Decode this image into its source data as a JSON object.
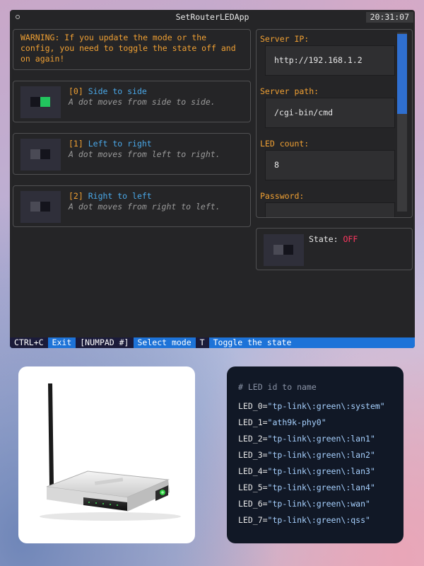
{
  "app": {
    "title": "SetRouterLEDApp",
    "clock": "20:31:07",
    "warning": "WARNING: If you update the mode or the config, you need to toggle the state off and on again!",
    "modes": [
      {
        "index": "[0]",
        "name": "Side to side",
        "desc": "A dot moves from side to side."
      },
      {
        "index": "[1]",
        "name": "Left to right",
        "desc": "A dot moves from left to right."
      },
      {
        "index": "[2]",
        "name": "Right to left",
        "desc": "A dot moves from right to left."
      }
    ],
    "form": {
      "server_ip_label": "Server IP:",
      "server_ip_value": "http://192.168.1.2",
      "server_path_label": "Server path:",
      "server_path_value": "/cgi-bin/cmd",
      "led_count_label": "LED count:",
      "led_count_value": "8",
      "password_label": "Password:",
      "password_value": ""
    },
    "state": {
      "label": "State:",
      "value": "OFF"
    },
    "footer": [
      {
        "key": "CTRL+C",
        "action": "Exit"
      },
      {
        "key": "[NUMPAD #]",
        "action": "Select mode"
      },
      {
        "key": "T",
        "action": "Toggle the state"
      }
    ]
  },
  "code": {
    "comment": "# LED id to name",
    "lines": [
      {
        "key": "LED_0=",
        "value": "\"tp-link\\:green\\:system\""
      },
      {
        "key": "LED_1=",
        "value": "\"ath9k-phy0\""
      },
      {
        "key": "LED_2=",
        "value": "\"tp-link\\:green\\:lan1\""
      },
      {
        "key": "LED_3=",
        "value": "\"tp-link\\:green\\:lan2\""
      },
      {
        "key": "LED_4=",
        "value": "\"tp-link\\:green\\:lan3\""
      },
      {
        "key": "LED_5=",
        "value": "\"tp-link\\:green\\:lan4\""
      },
      {
        "key": "LED_6=",
        "value": "\"tp-link\\:green\\:wan\""
      },
      {
        "key": "LED_7=",
        "value": "\"tp-link\\:green\\:qss\""
      }
    ]
  },
  "colors": {
    "accent_orange": "#f0a033",
    "accent_blue": "#4aa8e8",
    "footer_blue": "#1d73d8",
    "state_off": "#ff3860",
    "led_on": "#22c55e"
  },
  "icons": [
    "window-dot-icon",
    "router-image"
  ]
}
